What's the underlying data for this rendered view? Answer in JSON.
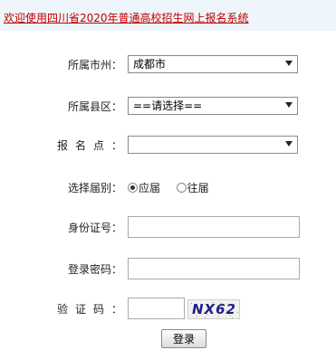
{
  "header": {
    "title": "欢迎使用四川省2020年普通高校招生网上报名系统"
  },
  "form": {
    "city": {
      "label": "所属市州：",
      "value": "成都市"
    },
    "county": {
      "label": "所属县区：",
      "value": "==请选择=="
    },
    "site": {
      "label": "报名点：",
      "value": ""
    },
    "session": {
      "label": "选择届别：",
      "options": [
        "应届",
        "往届"
      ],
      "selected": "应届"
    },
    "id_number": {
      "label": "身份证号：",
      "value": ""
    },
    "password": {
      "label": "登录密码：",
      "value": ""
    },
    "captcha": {
      "label": "验证码：",
      "value": "",
      "image_text": "NX62"
    },
    "submit_label": "登录"
  },
  "colors": {
    "header_bg": "#eef5fb",
    "header_link": "#c00000",
    "captcha_text": "#1f1f8a"
  }
}
